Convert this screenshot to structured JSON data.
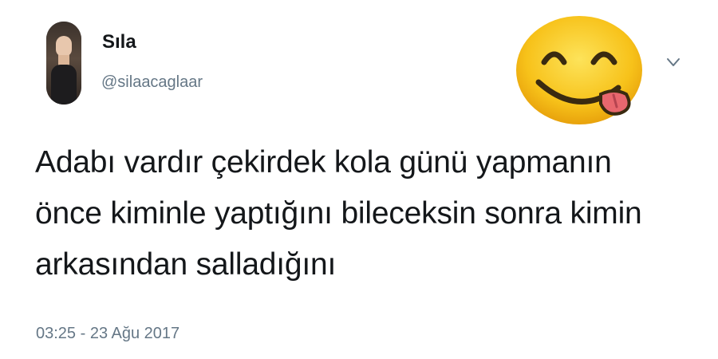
{
  "author": {
    "display_name": "Sıla",
    "handle": "@silaacaglaar"
  },
  "icons": {
    "avatar": "profile-photo",
    "emoji": "face-savoring-food-emoji",
    "menu": "chevron-down-icon"
  },
  "tweet": {
    "lines": [
      "Adabı vardır çekirdek kola günü yapmanın",
      "önce kiminle yaptığını bileceksin sonra kimin",
      "arkasından salladığını"
    ],
    "timestamp": "03:25 - 23 Ağu 2017"
  },
  "colors": {
    "text": "#14171a",
    "secondary": "#657786",
    "emoji_yellow": "#f7c21a",
    "tongue": "#e8676e"
  }
}
